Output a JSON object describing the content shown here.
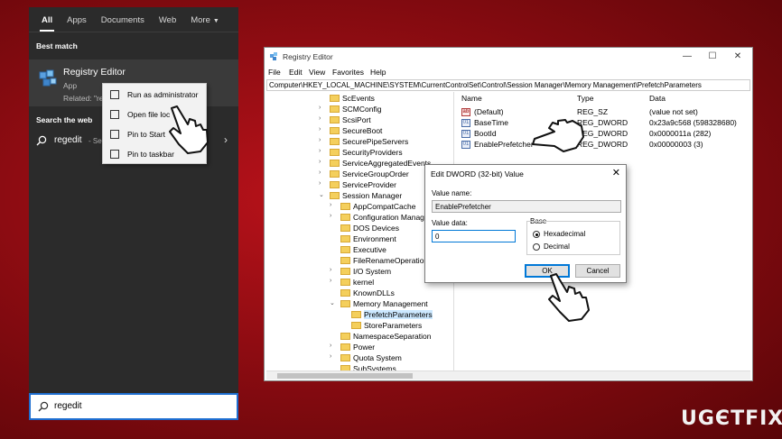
{
  "start": {
    "tabs": [
      "All",
      "Apps",
      "Documents",
      "Web",
      "More"
    ],
    "best_match_heading": "Best match",
    "best_match": {
      "title": "Registry Editor",
      "subtitle": "App",
      "related": "Related: \"re"
    },
    "web_heading": "Search the web",
    "web_query": "regedit",
    "web_see": "- See",
    "search_value": "regedit",
    "context_menu": [
      "Run as administrator",
      "Open file loc",
      "Pin to Start",
      "Pin to taskbar"
    ]
  },
  "registry": {
    "title": "Registry Editor",
    "menu": [
      "File",
      "Edit",
      "View",
      "Favorites",
      "Help"
    ],
    "address": "Computer\\HKEY_LOCAL_MACHINE\\SYSTEM\\CurrentControlSet\\Control\\Session Manager\\Memory Management\\PrefetchParameters",
    "tree": [
      "ScEvents",
      "SCMConfig",
      "ScsiPort",
      "SecureBoot",
      "SecurePipeServers",
      "SecurityProviders",
      "ServiceAggregatedEvents",
      "ServiceGroupOrder",
      "ServiceProvider",
      "Session Manager",
      "AppCompatCache",
      "Configuration Manager",
      "DOS Devices",
      "Environment",
      "Executive",
      "FileRenameOperations",
      "I/O System",
      "kernel",
      "KnownDLLs",
      "Memory Management",
      "PrefetchParameters",
      "StoreParameters",
      "NamespaceSeparation",
      "Power",
      "Quota System",
      "SubSystems"
    ],
    "columns": {
      "name": "Name",
      "type": "Type",
      "data": "Data"
    },
    "values": [
      {
        "name": "(Default)",
        "type": "REG_SZ",
        "data": "(value not set)"
      },
      {
        "name": "BaseTime",
        "type": "REG_DWORD",
        "data": "0x23a9c568 (598328680)"
      },
      {
        "name": "BootId",
        "type": "REG_DWORD",
        "data": "0x0000011a (282)"
      },
      {
        "name": "EnablePrefetcher",
        "type": "REG_DWORD",
        "data": "0x00000003 (3)"
      }
    ]
  },
  "dialog": {
    "title": "Edit DWORD (32-bit) Value",
    "value_name_label": "Value name:",
    "value_name": "EnablePrefetcher",
    "value_data_label": "Value data:",
    "value_data": "0",
    "base_label": "Base",
    "radio_hex": "Hexadecimal",
    "radio_dec": "Decimal",
    "ok": "OK",
    "cancel": "Cancel"
  },
  "watermark": "UGЄTFIX"
}
